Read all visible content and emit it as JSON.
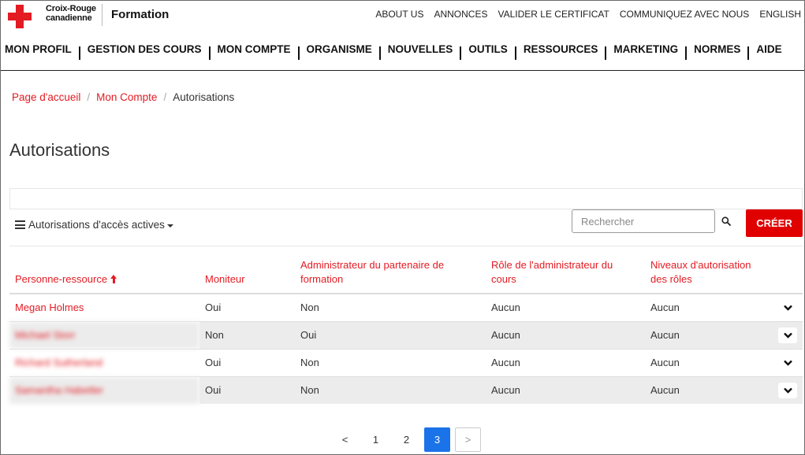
{
  "brand": {
    "org_line1": "Croix-Rouge",
    "org_line2": "canadienne",
    "product": "Formation",
    "accent_color": "#e31b23"
  },
  "util_nav": [
    "ABOUT US",
    "ANNONCES",
    "VALIDER LE CERTIFICAT",
    "COMMUNIQUEZ AVEC NOUS",
    "ENGLISH"
  ],
  "main_nav": [
    "MON PROFIL",
    "GESTION DES COURS",
    "MON COMPTE",
    "ORGANISME",
    "NOUVELLES",
    "OUTILS",
    "RESSOURCES",
    "MARKETING",
    "NORMES",
    "AIDE"
  ],
  "breadcrumb": {
    "home": "Page d'accueil",
    "account": "Mon Compte",
    "current": "Autorisations"
  },
  "page": {
    "title": "Autorisations",
    "filter_dropdown": "Autorisations d'accès actives",
    "search_placeholder": "Rechercher",
    "create_label": "CRÉER"
  },
  "table": {
    "headers": [
      "Personne-ressource",
      "Moniteur",
      "Administrateur du partenaire de formation",
      "Rôle de l'administrateur du cours",
      "Niveaux d'autorisation des rôles"
    ],
    "sort_column": "Personne-ressource",
    "sort_direction": "ascending",
    "rows": [
      {
        "name": "Megan Holmes",
        "moniteur": "Oui",
        "admin_partenaire": "Non",
        "role_admin": "Aucun",
        "niveaux": "Aucun"
      },
      {
        "name": "Michael Storr",
        "moniteur": "Non",
        "admin_partenaire": "Oui",
        "role_admin": "Aucun",
        "niveaux": "Aucun"
      },
      {
        "name": "Richard Sutherland",
        "moniteur": "Oui",
        "admin_partenaire": "Non",
        "role_admin": "Aucun",
        "niveaux": "Aucun"
      },
      {
        "name": "Samantha Habetler",
        "moniteur": "Oui",
        "admin_partenaire": "Non",
        "role_admin": "Aucun",
        "niveaux": "Aucun"
      }
    ]
  },
  "pagination": {
    "prev": "<",
    "pages": [
      "1",
      "2",
      "3"
    ],
    "current": "3",
    "next": ">",
    "active_color": "#1a73e8"
  }
}
